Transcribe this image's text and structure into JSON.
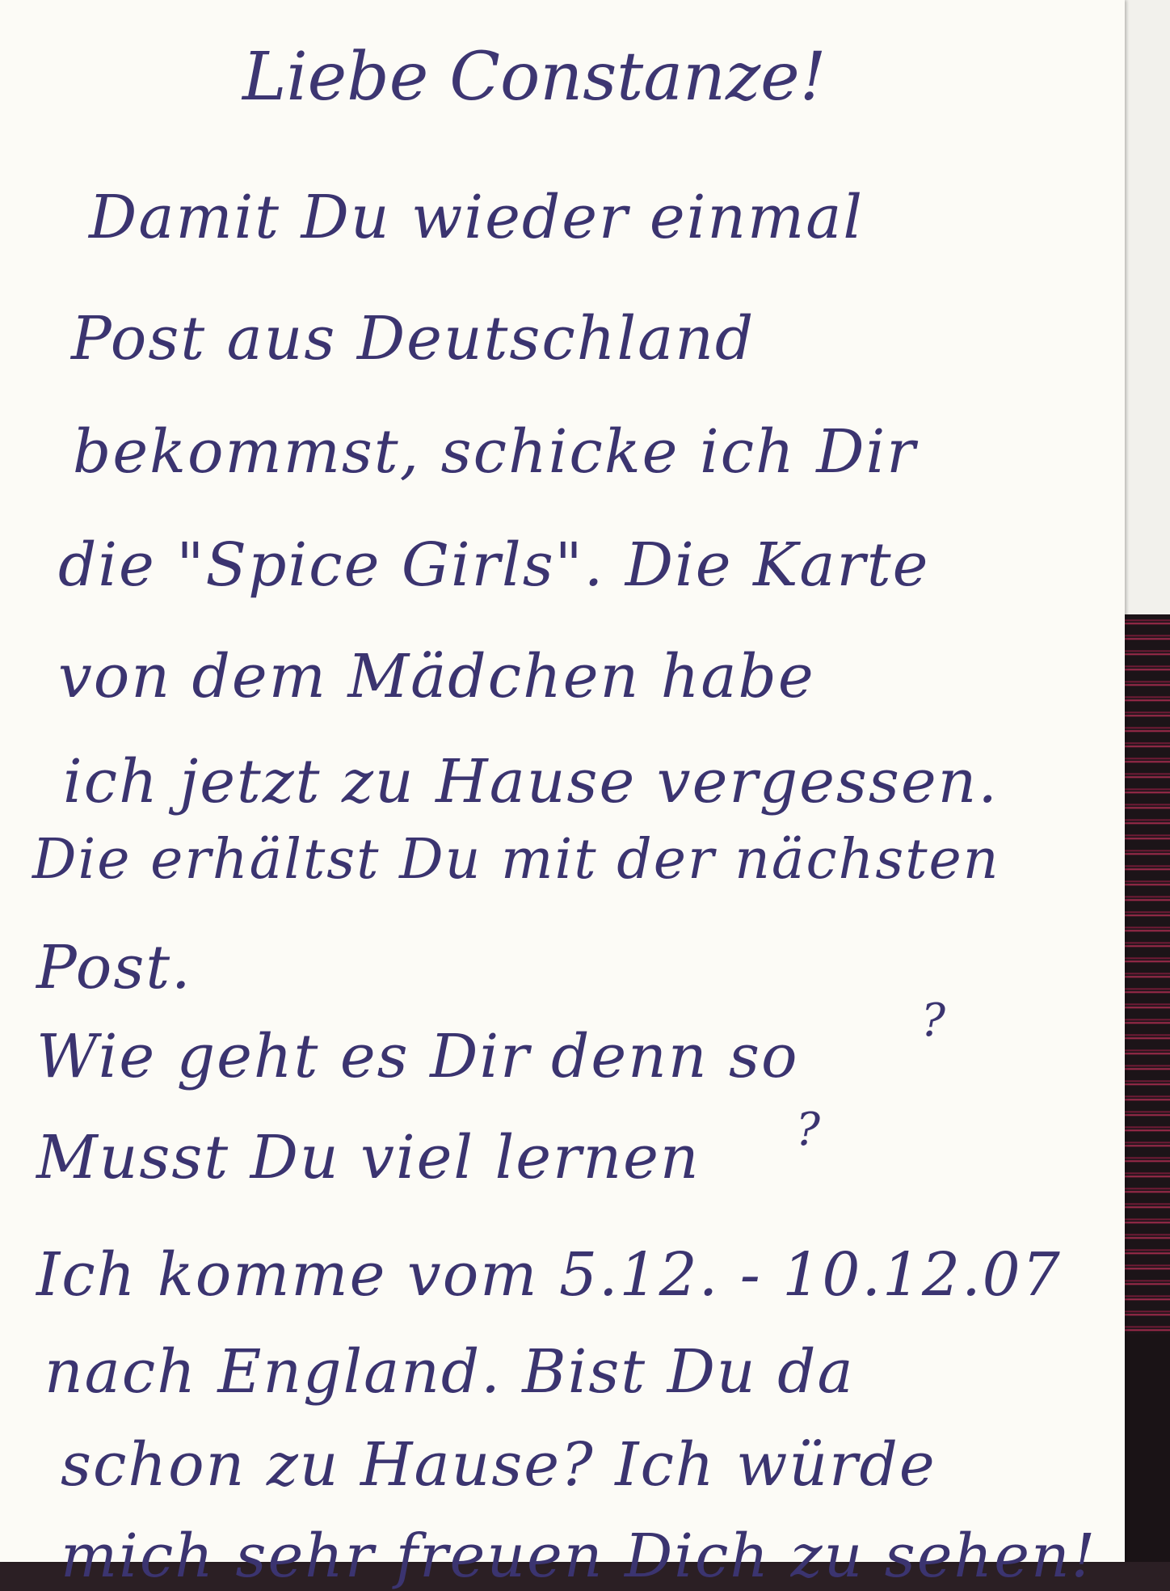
{
  "letter": {
    "greeting": "Liebe Constanze!",
    "lines": [
      "Damit Du wieder einmal",
      "Post aus Deutschland",
      "bekommst, schicke ich Dir",
      "die \"Spice Girls\". Die Karte",
      "von dem Mädchen habe",
      "ich jetzt zu Hause vergessen.",
      "Die erhältst Du mit der nächsten",
      "Post.",
      "Wie geht es Dir denn so",
      "Musst Du viel lernen",
      "Ich komme vom 5.12. - 10.12.07",
      "nach England. Bist Du da",
      "schon zu Hause? Ich würde",
      "mich sehr freuen Dich zu sehen!"
    ],
    "question_marks": [
      "?",
      "?"
    ]
  },
  "colors": {
    "ink": "#3b3470",
    "paper": "#fcfbf6",
    "backdrop_accent": "#c4305a"
  }
}
